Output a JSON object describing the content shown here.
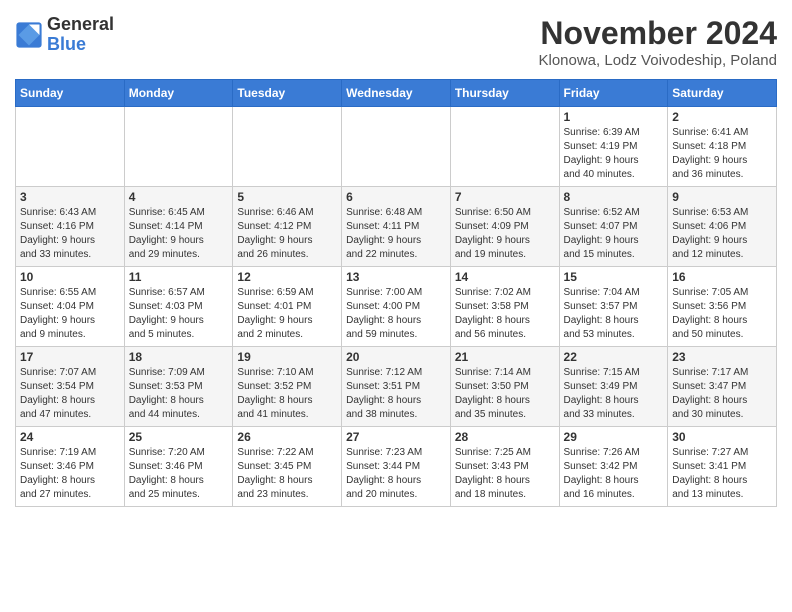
{
  "header": {
    "logo_line1": "General",
    "logo_line2": "Blue",
    "month": "November 2024",
    "location": "Klonowa, Lodz Voivodeship, Poland"
  },
  "days_of_week": [
    "Sunday",
    "Monday",
    "Tuesday",
    "Wednesday",
    "Thursday",
    "Friday",
    "Saturday"
  ],
  "weeks": [
    [
      {
        "day": "",
        "info": ""
      },
      {
        "day": "",
        "info": ""
      },
      {
        "day": "",
        "info": ""
      },
      {
        "day": "",
        "info": ""
      },
      {
        "day": "",
        "info": ""
      },
      {
        "day": "1",
        "info": "Sunrise: 6:39 AM\nSunset: 4:19 PM\nDaylight: 9 hours\nand 40 minutes."
      },
      {
        "day": "2",
        "info": "Sunrise: 6:41 AM\nSunset: 4:18 PM\nDaylight: 9 hours\nand 36 minutes."
      }
    ],
    [
      {
        "day": "3",
        "info": "Sunrise: 6:43 AM\nSunset: 4:16 PM\nDaylight: 9 hours\nand 33 minutes."
      },
      {
        "day": "4",
        "info": "Sunrise: 6:45 AM\nSunset: 4:14 PM\nDaylight: 9 hours\nand 29 minutes."
      },
      {
        "day": "5",
        "info": "Sunrise: 6:46 AM\nSunset: 4:12 PM\nDaylight: 9 hours\nand 26 minutes."
      },
      {
        "day": "6",
        "info": "Sunrise: 6:48 AM\nSunset: 4:11 PM\nDaylight: 9 hours\nand 22 minutes."
      },
      {
        "day": "7",
        "info": "Sunrise: 6:50 AM\nSunset: 4:09 PM\nDaylight: 9 hours\nand 19 minutes."
      },
      {
        "day": "8",
        "info": "Sunrise: 6:52 AM\nSunset: 4:07 PM\nDaylight: 9 hours\nand 15 minutes."
      },
      {
        "day": "9",
        "info": "Sunrise: 6:53 AM\nSunset: 4:06 PM\nDaylight: 9 hours\nand 12 minutes."
      }
    ],
    [
      {
        "day": "10",
        "info": "Sunrise: 6:55 AM\nSunset: 4:04 PM\nDaylight: 9 hours\nand 9 minutes."
      },
      {
        "day": "11",
        "info": "Sunrise: 6:57 AM\nSunset: 4:03 PM\nDaylight: 9 hours\nand 5 minutes."
      },
      {
        "day": "12",
        "info": "Sunrise: 6:59 AM\nSunset: 4:01 PM\nDaylight: 9 hours\nand 2 minutes."
      },
      {
        "day": "13",
        "info": "Sunrise: 7:00 AM\nSunset: 4:00 PM\nDaylight: 8 hours\nand 59 minutes."
      },
      {
        "day": "14",
        "info": "Sunrise: 7:02 AM\nSunset: 3:58 PM\nDaylight: 8 hours\nand 56 minutes."
      },
      {
        "day": "15",
        "info": "Sunrise: 7:04 AM\nSunset: 3:57 PM\nDaylight: 8 hours\nand 53 minutes."
      },
      {
        "day": "16",
        "info": "Sunrise: 7:05 AM\nSunset: 3:56 PM\nDaylight: 8 hours\nand 50 minutes."
      }
    ],
    [
      {
        "day": "17",
        "info": "Sunrise: 7:07 AM\nSunset: 3:54 PM\nDaylight: 8 hours\nand 47 minutes."
      },
      {
        "day": "18",
        "info": "Sunrise: 7:09 AM\nSunset: 3:53 PM\nDaylight: 8 hours\nand 44 minutes."
      },
      {
        "day": "19",
        "info": "Sunrise: 7:10 AM\nSunset: 3:52 PM\nDaylight: 8 hours\nand 41 minutes."
      },
      {
        "day": "20",
        "info": "Sunrise: 7:12 AM\nSunset: 3:51 PM\nDaylight: 8 hours\nand 38 minutes."
      },
      {
        "day": "21",
        "info": "Sunrise: 7:14 AM\nSunset: 3:50 PM\nDaylight: 8 hours\nand 35 minutes."
      },
      {
        "day": "22",
        "info": "Sunrise: 7:15 AM\nSunset: 3:49 PM\nDaylight: 8 hours\nand 33 minutes."
      },
      {
        "day": "23",
        "info": "Sunrise: 7:17 AM\nSunset: 3:47 PM\nDaylight: 8 hours\nand 30 minutes."
      }
    ],
    [
      {
        "day": "24",
        "info": "Sunrise: 7:19 AM\nSunset: 3:46 PM\nDaylight: 8 hours\nand 27 minutes."
      },
      {
        "day": "25",
        "info": "Sunrise: 7:20 AM\nSunset: 3:46 PM\nDaylight: 8 hours\nand 25 minutes."
      },
      {
        "day": "26",
        "info": "Sunrise: 7:22 AM\nSunset: 3:45 PM\nDaylight: 8 hours\nand 23 minutes."
      },
      {
        "day": "27",
        "info": "Sunrise: 7:23 AM\nSunset: 3:44 PM\nDaylight: 8 hours\nand 20 minutes."
      },
      {
        "day": "28",
        "info": "Sunrise: 7:25 AM\nSunset: 3:43 PM\nDaylight: 8 hours\nand 18 minutes."
      },
      {
        "day": "29",
        "info": "Sunrise: 7:26 AM\nSunset: 3:42 PM\nDaylight: 8 hours\nand 16 minutes."
      },
      {
        "day": "30",
        "info": "Sunrise: 7:27 AM\nSunset: 3:41 PM\nDaylight: 8 hours\nand 13 minutes."
      }
    ]
  ]
}
